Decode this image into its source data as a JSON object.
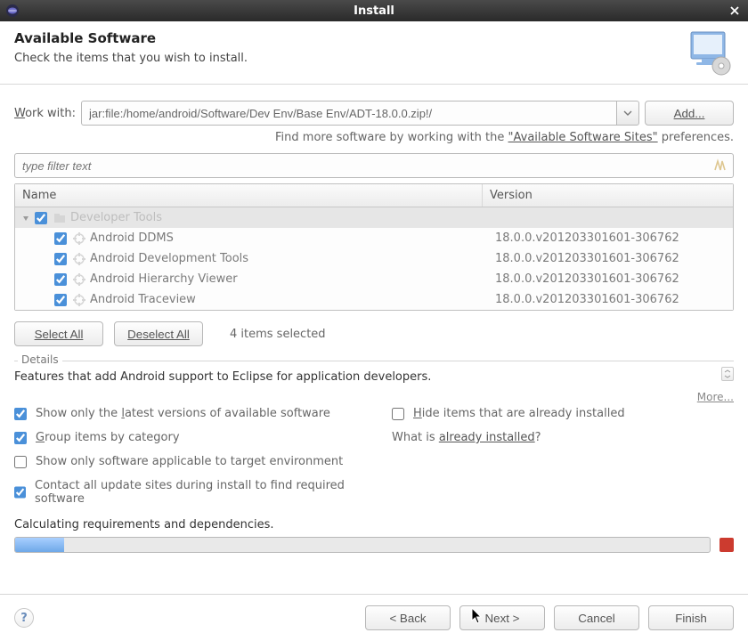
{
  "window": {
    "title": "Install"
  },
  "header": {
    "title": "Available Software",
    "subtitle": "Check the items that you wish to install."
  },
  "workwith": {
    "label_pre": "W",
    "label_post": "ork with:",
    "value": "jar:file:/home/android/Software/Dev Env/Base Env/ADT-18.0.0.zip!/",
    "add": "Add..."
  },
  "hint": {
    "pre": "Find more software by working with the ",
    "link": "\"Available Software Sites\"",
    "post": " preferences."
  },
  "filter": {
    "placeholder": "type filter text"
  },
  "columns": {
    "name": "Name",
    "version": "Version"
  },
  "tree": {
    "root": {
      "label": "Developer Tools"
    },
    "items": [
      {
        "name": "Android DDMS",
        "version": "18.0.0.v201203301601-306762"
      },
      {
        "name": "Android Development Tools",
        "version": "18.0.0.v201203301601-306762"
      },
      {
        "name": "Android Hierarchy Viewer",
        "version": "18.0.0.v201203301601-306762"
      },
      {
        "name": "Android Traceview",
        "version": "18.0.0.v201203301601-306762"
      }
    ]
  },
  "actions": {
    "select_all": "Select All",
    "deselect_all": "Deselect All",
    "count": "4 items selected"
  },
  "details": {
    "legend": "Details",
    "text": "Features that add Android support to Eclipse for application developers.",
    "more": "More..."
  },
  "options": {
    "show_latest_pre": "Show only the ",
    "show_latest_u": "l",
    "show_latest_post": "atest versions of available software",
    "hide_installed_pre": "",
    "hide_installed_u": "H",
    "hide_installed_post": "ide items that are already installed",
    "group_pre": "",
    "group_u": "G",
    "group_post": "roup items by category",
    "what_pre": "What is ",
    "what_link": "already installed",
    "what_post": "?",
    "applicable": "Show only software applicable to target environment",
    "contact": "Contact all update sites during install to find required software"
  },
  "status": {
    "text": "Calculating requirements and dependencies."
  },
  "footer": {
    "back": "< Back",
    "next": "Next >",
    "cancel": "Cancel",
    "finish": "Finish"
  }
}
